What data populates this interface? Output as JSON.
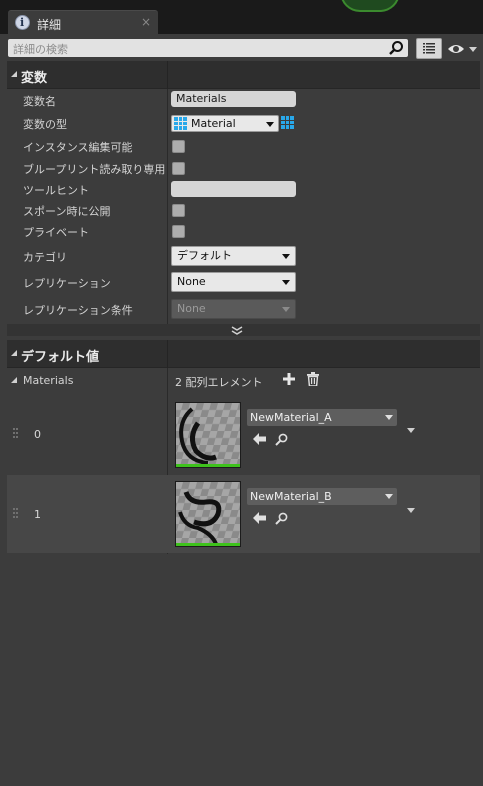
{
  "tab": {
    "title": "詳細",
    "close": "×"
  },
  "search": {
    "placeholder": "詳細の検索"
  },
  "variables_section": {
    "title": "変数",
    "rows": [
      {
        "label": "変数名",
        "value": "Materials"
      },
      {
        "label": "変数の型",
        "value": "Material"
      },
      {
        "label": "インスタンス編集可能"
      },
      {
        "label": "ブループリント読み取り専用"
      },
      {
        "label": "ツールヒント",
        "value": ""
      },
      {
        "label": "スポーン時に公開"
      },
      {
        "label": "プライベート"
      },
      {
        "label": "カテゴリ",
        "value": "デフォルト"
      },
      {
        "label": "レプリケーション",
        "value": "None"
      },
      {
        "label": "レプリケーション条件",
        "value": "None"
      }
    ]
  },
  "defaults_section": {
    "title": "デフォルト値",
    "array": {
      "label": "Materials",
      "count_text": "2 配列エレメント",
      "elements": [
        {
          "index": "0",
          "asset": "NewMaterial_A"
        },
        {
          "index": "1",
          "asset": "NewMaterial_B"
        }
      ]
    }
  },
  "colors": {
    "accent_blue": "#29a8ea",
    "thumbnail_bar": "#3ec21c",
    "panel_bg": "#3c3c3c"
  },
  "icons": [
    "info-icon",
    "close-icon",
    "search-icon",
    "list-view-icon",
    "eye-icon",
    "grid-type-icon",
    "plus-icon",
    "trash-icon",
    "back-arrow-icon",
    "browse-icon",
    "chevron-down-icon"
  ]
}
